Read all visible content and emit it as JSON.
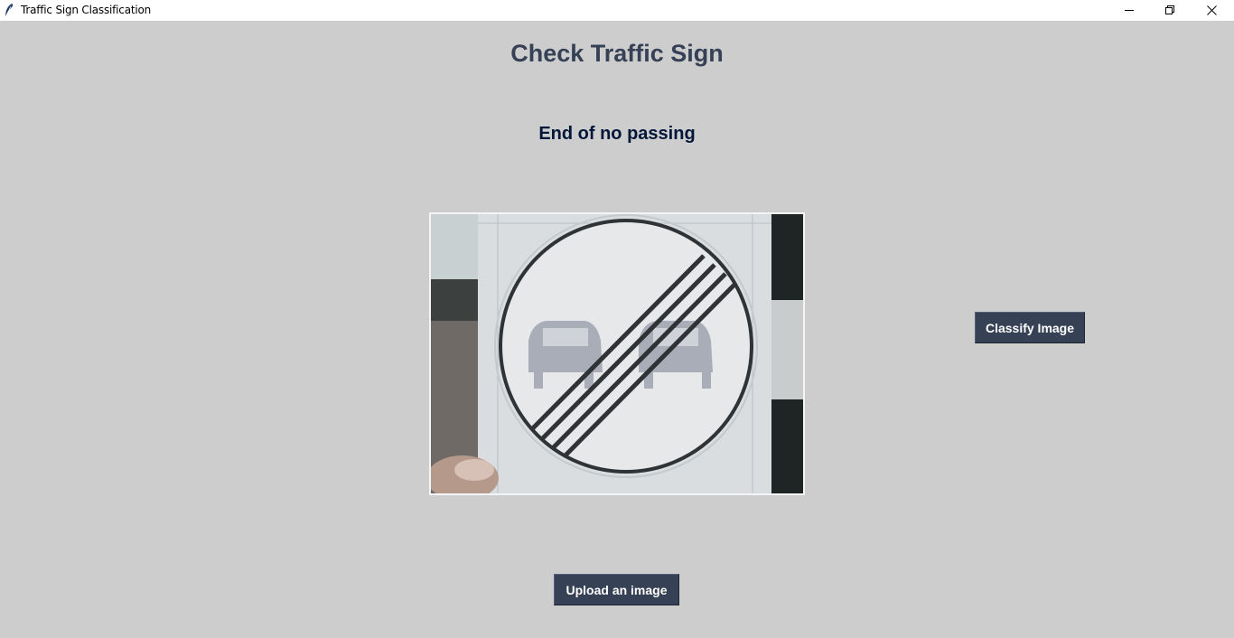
{
  "window": {
    "title": "Traffic Sign Classification",
    "icon": "feather-icon",
    "controls": [
      "minimize-icon",
      "restore-icon",
      "close-icon"
    ]
  },
  "main": {
    "heading": "Check Traffic Sign",
    "result": "End of no passing",
    "image_alt": "uploaded-traffic-sign-image"
  },
  "buttons": {
    "classify_label": "Classify Image",
    "upload_label": "Upload an image"
  },
  "colors": {
    "background": "#cdcdcd",
    "heading": "#364156",
    "result": "#011638",
    "button_bg": "#364156",
    "button_text": "#ffffff"
  }
}
